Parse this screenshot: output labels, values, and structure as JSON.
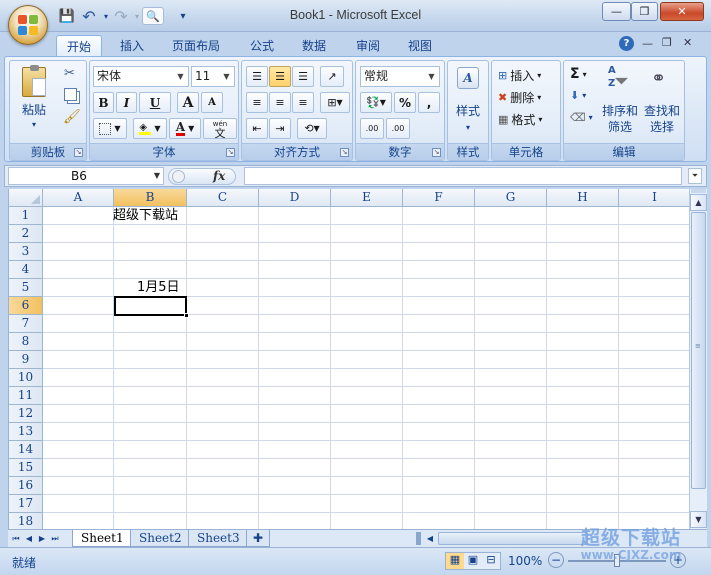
{
  "window": {
    "title": "Book1 - Microsoft Excel",
    "controls": [
      "—",
      "❐",
      "✕"
    ]
  },
  "quick_access": {
    "save": "💾",
    "undo": "↶",
    "redo": "↷",
    "preview": "🔍",
    "customize": "▾"
  },
  "tabs": [
    "开始",
    "插入",
    "页面布局",
    "公式",
    "数据",
    "审阅",
    "视图"
  ],
  "ribbon_right_icons": [
    "?",
    "—",
    "❐",
    "✕"
  ],
  "groups": {
    "clipboard": {
      "label": "剪贴板",
      "paste": "粘贴",
      "paste_arrow": "▾"
    },
    "font": {
      "label": "字体",
      "font_name": "宋体",
      "font_size": "11",
      "bold": "B",
      "italic": "I",
      "underline": "U",
      "grow": "A",
      "shrink": "A",
      "wen": "wén",
      "wen_char": "文"
    },
    "alignment": {
      "label": "对齐方式"
    },
    "number": {
      "label": "数字",
      "format": "常规",
      "percent": "%",
      "comma": ",",
      "inc_decimal": ".00",
      "dec_decimal": ".00"
    },
    "styles": {
      "label": "样式",
      "button": "样式"
    },
    "cells": {
      "label": "单元格",
      "insert": "插入",
      "delete": "删除",
      "format": "格式"
    },
    "editing": {
      "label": "编辑",
      "sigma": "Σ",
      "sort_line1": "排序和",
      "sort_line2": "筛选",
      "find_line1": "查找和",
      "find_line2": "选择"
    }
  },
  "formula_bar": {
    "name_box": "B6",
    "fx": "fx",
    "content": ""
  },
  "columns": [
    "A",
    "B",
    "C",
    "D",
    "E",
    "F",
    "G",
    "H",
    "I"
  ],
  "rows": [
    "1",
    "2",
    "3",
    "4",
    "5",
    "6",
    "7",
    "8",
    "9",
    "10",
    "11",
    "12",
    "13",
    "14",
    "15",
    "16",
    "17",
    "18"
  ],
  "cells": {
    "B1": "超级下载站",
    "B5": "1月5日"
  },
  "selected_cell": "B6",
  "sheets": [
    "Sheet1",
    "Sheet2",
    "Sheet3"
  ],
  "active_sheet": "Sheet1",
  "status": {
    "ready": "就绪",
    "zoom": "100%"
  },
  "watermark": {
    "line1": "超级下载站",
    "line2": "www.CJXZ.com"
  },
  "colors": {
    "accent": "#15428b",
    "selected_header": "#f1c15f",
    "ribbon_bg": "#dbe7f5"
  }
}
